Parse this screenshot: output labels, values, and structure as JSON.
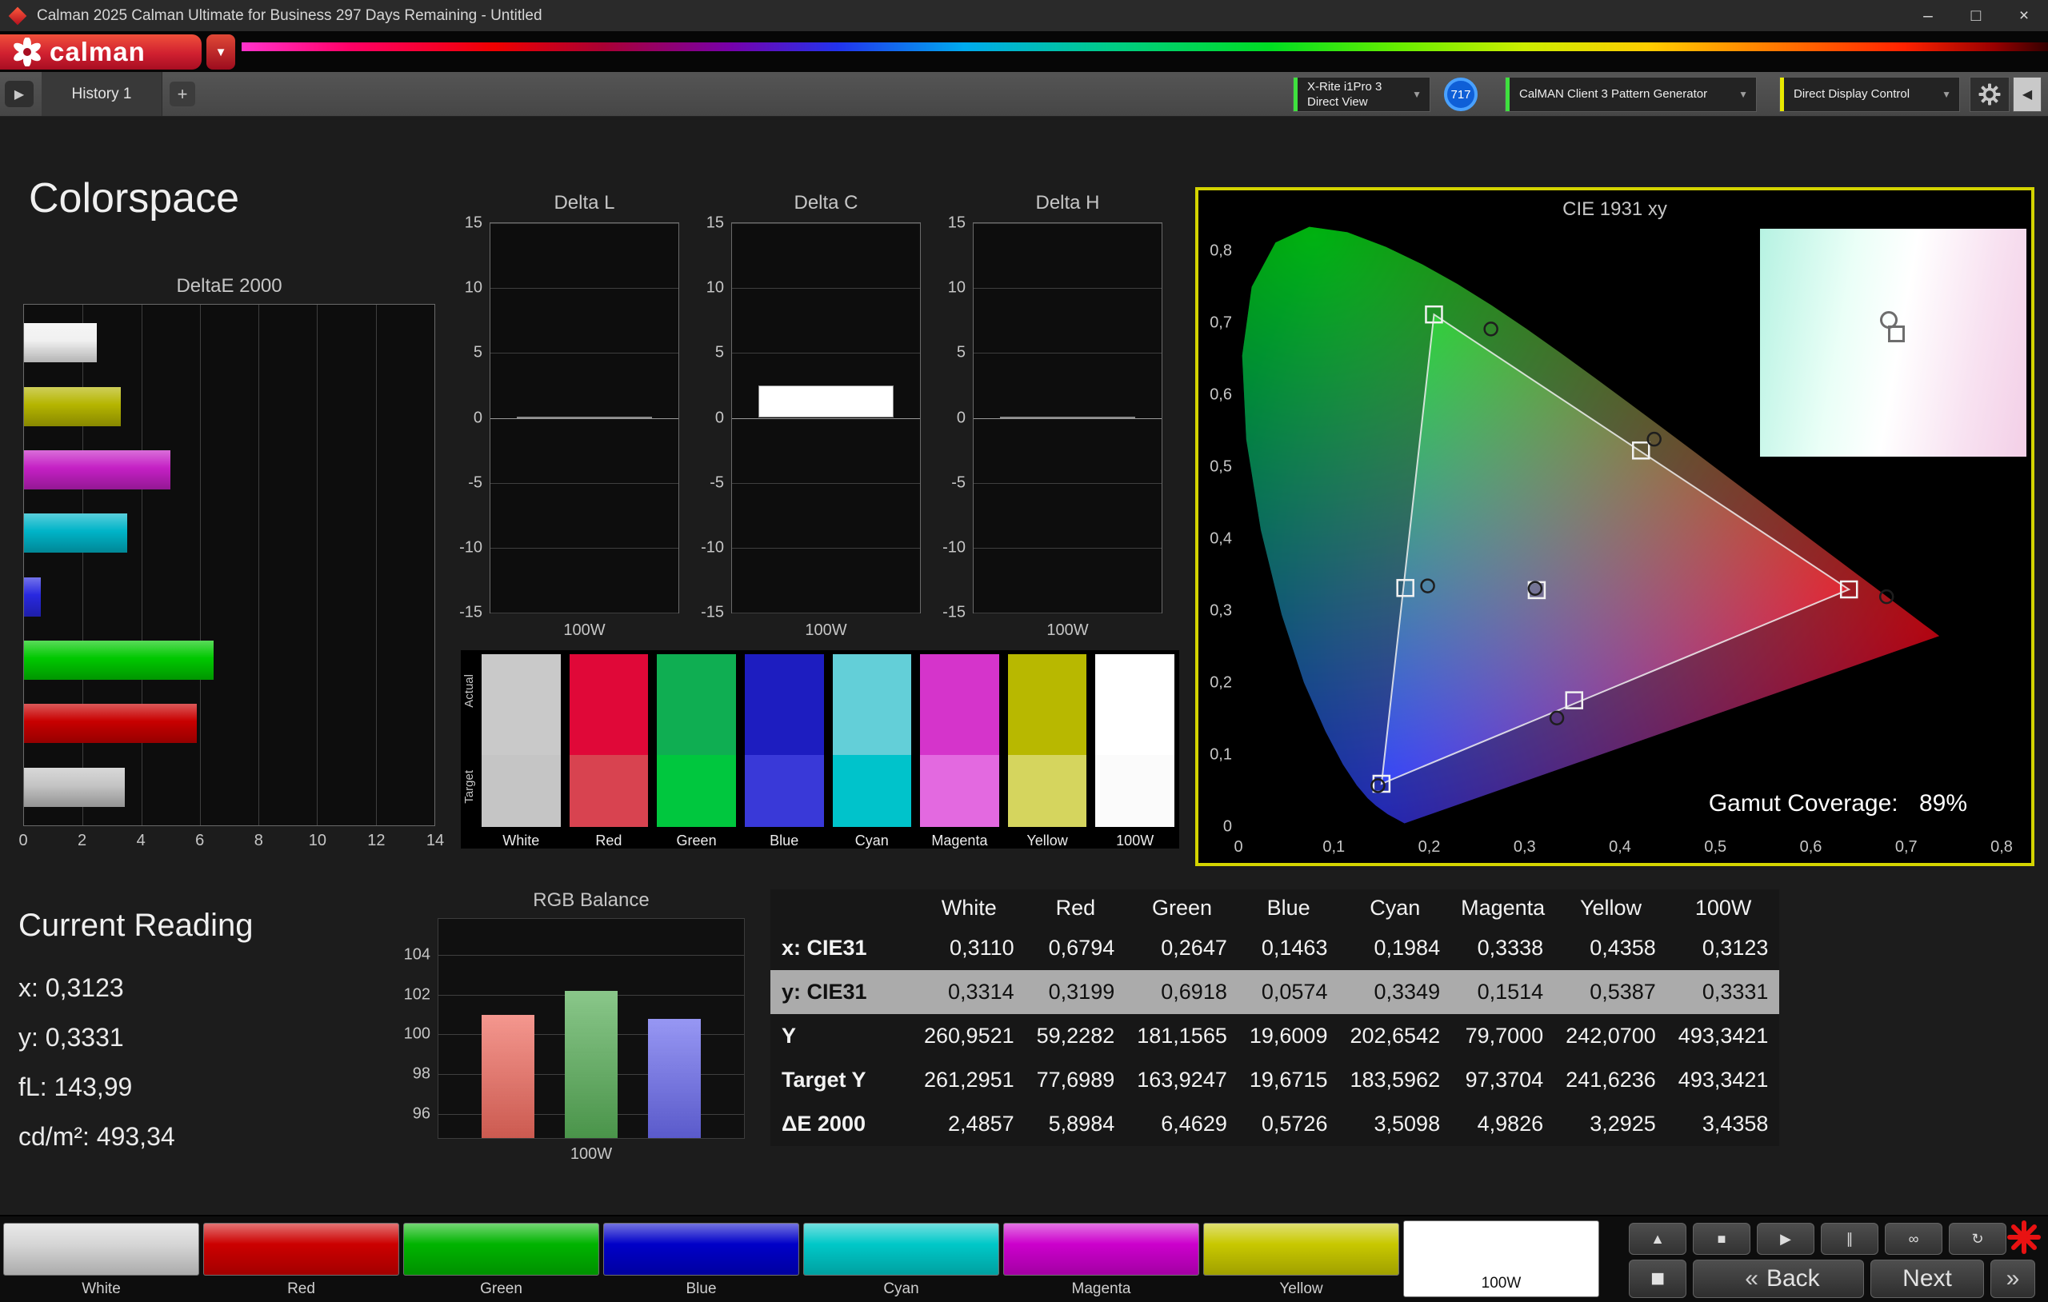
{
  "window": {
    "title": "Calman 2025 Calman Ultimate for Business 297 Days Remaining  - Untitled",
    "minimize_glyph": "–",
    "maximize_glyph": "□",
    "close_glyph": "×"
  },
  "brand": {
    "logo_text": "calman",
    "caret": "▼"
  },
  "tabs": {
    "nav_glyph": "▶",
    "history_tab": "History 1",
    "add_tab": "+"
  },
  "devices": {
    "meter_line1": "X-Rite i1Pro 3",
    "meter_line2": "Direct View",
    "badge": "717",
    "pattern_generator": "CalMAN Client 3 Pattern Generator",
    "display_control": "Direct Display Control",
    "caret": "▼",
    "collapse_glyph": "◀",
    "accent_green": "#3fe03f",
    "accent_yellow": "#e8e800"
  },
  "page_title": "Colorspace",
  "current_reading": {
    "title": "Current Reading",
    "lines": [
      "x: 0,3123",
      "y: 0,3331",
      "fL: 143,99",
      "cd/m²: 493,34"
    ]
  },
  "gamut": {
    "label": "Gamut Coverage:",
    "value": "89%"
  },
  "swatches": {
    "row_labels": [
      "Actual",
      "Target"
    ],
    "items": [
      {
        "label": "White",
        "actual": "#c9c9c9",
        "target": "#c5c5c5"
      },
      {
        "label": "Red",
        "actual": "#e00838",
        "target": "#d84350"
      },
      {
        "label": "Green",
        "actual": "#0fae52",
        "target": "#00c73e"
      },
      {
        "label": "Blue",
        "actual": "#1d1dc0",
        "target": "#3939d8"
      },
      {
        "label": "Cyan",
        "actual": "#63cfd8",
        "target": "#00c3cb"
      },
      {
        "label": "Magenta",
        "actual": "#d534cb",
        "target": "#e369e0"
      },
      {
        "label": "Yellow",
        "actual": "#b8b800",
        "target": "#d5d55e"
      },
      {
        "label": "100W",
        "actual": "#ffffff",
        "target": "#fbfbfb"
      }
    ]
  },
  "table": {
    "columns": [
      "White",
      "Red",
      "Green",
      "Blue",
      "Cyan",
      "Magenta",
      "Yellow",
      "100W"
    ],
    "rows": [
      {
        "label": "x: CIE31",
        "values": [
          "0,3110",
          "0,6794",
          "0,2647",
          "0,1463",
          "0,1984",
          "0,3338",
          "0,4358",
          "0,3123"
        ]
      },
      {
        "label": "y: CIE31",
        "values": [
          "0,3314",
          "0,3199",
          "0,6918",
          "0,0574",
          "0,3349",
          "0,1514",
          "0,5387",
          "0,3331"
        ]
      },
      {
        "label": "Y",
        "values": [
          "260,9521",
          "59,2282",
          "181,1565",
          "19,6009",
          "202,6542",
          "79,7000",
          "242,0700",
          "493,3421"
        ]
      },
      {
        "label": "Target Y",
        "values": [
          "261,2951",
          "77,6989",
          "163,9247",
          "19,6715",
          "183,5962",
          "97,3704",
          "241,6236",
          "493,3421"
        ]
      },
      {
        "label": "ΔE 2000",
        "values": [
          "2,4857",
          "5,8984",
          "6,4629",
          "0,5726",
          "3,5098",
          "4,9826",
          "3,2925",
          "3,4358"
        ]
      }
    ]
  },
  "chart_data": [
    {
      "id": "deltaE2000",
      "type": "bar",
      "orientation": "horizontal",
      "title": "DeltaE 2000",
      "categories": [
        "White",
        "Yellow",
        "Magenta",
        "Cyan",
        "Blue",
        "Green",
        "Red",
        "100W"
      ],
      "values": [
        2.4857,
        3.2925,
        4.9826,
        3.5098,
        0.5726,
        6.4629,
        5.8984,
        3.4358
      ],
      "colors": [
        "#f0f0f0",
        "#b5b500",
        "#c520c5",
        "#00b4c8",
        "#2828e0",
        "#00c800",
        "#c80000",
        "#c4c4c4"
      ],
      "xlim": [
        0,
        14
      ],
      "x_ticks": [
        0,
        2,
        4,
        6,
        8,
        10,
        12,
        14
      ],
      "grid": true
    },
    {
      "id": "delta_l",
      "type": "bar",
      "title": "Delta L",
      "categories": [
        "100W"
      ],
      "values": [
        0.1
      ],
      "ylim": [
        -15,
        15
      ],
      "y_ticks": [
        15,
        10,
        5,
        0,
        -5,
        -10,
        -15
      ],
      "bar_color": "#ffffff",
      "xlabel": "100W"
    },
    {
      "id": "delta_c",
      "type": "bar",
      "title": "Delta C",
      "categories": [
        "100W"
      ],
      "values": [
        2.5
      ],
      "ylim": [
        -15,
        15
      ],
      "y_ticks": [
        15,
        10,
        5,
        0,
        -5,
        -10,
        -15
      ],
      "bar_color": "#ffffff",
      "xlabel": "100W"
    },
    {
      "id": "delta_h",
      "type": "bar",
      "title": "Delta H",
      "categories": [
        "100W"
      ],
      "values": [
        0.1
      ],
      "ylim": [
        -15,
        15
      ],
      "y_ticks": [
        15,
        10,
        5,
        0,
        -5,
        -10,
        -15
      ],
      "bar_color": "#ffffff",
      "xlabel": "100W"
    },
    {
      "id": "rgb_balance",
      "type": "bar",
      "title": "RGB Balance",
      "categories": [
        "Red",
        "Green",
        "Blue"
      ],
      "values": [
        101.0,
        102.2,
        100.8
      ],
      "colors": [
        "#ef6a5e",
        "#57ae57",
        "#6a6aee"
      ],
      "ylim": [
        94.8,
        105.8
      ],
      "y_ticks": [
        104,
        102,
        100,
        98,
        96
      ],
      "xlabel": "100W"
    },
    {
      "id": "cie1931",
      "type": "scatter",
      "title": "CIE 1931 xy",
      "xlim": [
        0,
        0.8
      ],
      "ylim": [
        0,
        0.8
      ],
      "x_tick_labels": [
        "0",
        "0,1",
        "0,2",
        "0,3",
        "0,4",
        "0,5",
        "0,6",
        "0,7",
        "0,8"
      ],
      "y_tick_labels": [
        "0",
        "0,1",
        "0,2",
        "0,3",
        "0,4",
        "0,5",
        "0,6",
        "0,7",
        "0,8"
      ],
      "target_triangle": [
        [
          0.205,
          0.712
        ],
        [
          0.64,
          0.33
        ],
        [
          0.15,
          0.06
        ]
      ],
      "targets": [
        {
          "name": "White",
          "x": 0.3127,
          "y": 0.329
        },
        {
          "name": "Red",
          "x": 0.64,
          "y": 0.33
        },
        {
          "name": "Green",
          "x": 0.205,
          "y": 0.712
        },
        {
          "name": "Blue",
          "x": 0.15,
          "y": 0.06
        },
        {
          "name": "Cyan",
          "x": 0.175,
          "y": 0.332
        },
        {
          "name": "Magenta",
          "x": 0.352,
          "y": 0.176
        },
        {
          "name": "Yellow",
          "x": 0.422,
          "y": 0.523
        }
      ],
      "measured": [
        {
          "name": "White",
          "x": 0.311,
          "y": 0.3314
        },
        {
          "name": "Red",
          "x": 0.6794,
          "y": 0.3199
        },
        {
          "name": "Green",
          "x": 0.2647,
          "y": 0.6918
        },
        {
          "name": "Blue",
          "x": 0.1463,
          "y": 0.0574
        },
        {
          "name": "Cyan",
          "x": 0.1984,
          "y": 0.3349
        },
        {
          "name": "Magenta",
          "x": 0.3338,
          "y": 0.1514
        },
        {
          "name": "Yellow",
          "x": 0.4358,
          "y": 0.5387
        }
      ],
      "gamut_coverage": "89%"
    }
  ],
  "patches": [
    {
      "label": "White",
      "color": "#d6d6d6",
      "selected": false
    },
    {
      "label": "Red",
      "color": "#cc0000",
      "selected": false
    },
    {
      "label": "Green",
      "color": "#00b400",
      "selected": false
    },
    {
      "label": "Blue",
      "color": "#0000c8",
      "selected": false
    },
    {
      "label": "Cyan",
      "color": "#00c8c8",
      "selected": false
    },
    {
      "label": "Magenta",
      "color": "#cc00cc",
      "selected": false
    },
    {
      "label": "Yellow",
      "color": "#c8c800",
      "selected": false
    },
    {
      "label": "100W",
      "color": "#ffffff",
      "selected": true
    }
  ],
  "transport": {
    "buttons": [
      {
        "name": "eject",
        "glyph": "▲"
      },
      {
        "name": "stop",
        "glyph": "■"
      },
      {
        "name": "play",
        "glyph": "▶"
      },
      {
        "name": "pause",
        "glyph": "∥"
      },
      {
        "name": "continuous",
        "glyph": "∞"
      },
      {
        "name": "loop",
        "glyph": "↻"
      }
    ],
    "stop_large_glyph": "■",
    "back_chevron": "«",
    "back_label": "Back",
    "next_label": "Next",
    "next_chevron": "»"
  }
}
